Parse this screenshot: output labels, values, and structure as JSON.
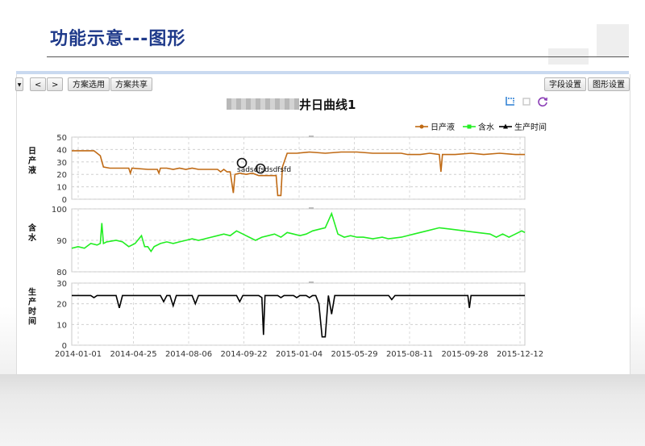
{
  "slide": {
    "title": "功能示意---图形"
  },
  "toolbar": {
    "prev_label": "<",
    "next_label": ">",
    "scheme_select_label": "方案选用",
    "scheme_share_label": "方案共享",
    "field_settings_label": "字段设置",
    "chart_settings_label": "图形设置"
  },
  "chart_title": {
    "suffix": "井日曲线1"
  },
  "icons": {
    "select": "select-icon",
    "crop": "crop-icon",
    "refresh": "refresh-icon"
  },
  "chart_data": {
    "type": "line",
    "title": "井日曲线1",
    "legend": {
      "position": "top-right",
      "entries": [
        "日产液",
        "含水",
        "生产时间"
      ]
    },
    "x_ticks": [
      "2014-01-01",
      "2014-04-25",
      "2014-08-06",
      "2014-09-22",
      "2015-01-04",
      "2015-05-29",
      "2015-08-11",
      "2015-09-28",
      "2015-12-12"
    ],
    "x_index_range": [
      0,
      100
    ],
    "annotation": "sadsdfsdsdfsfd",
    "panels": [
      {
        "ylabel": "日产液",
        "ylim": [
          0,
          50
        ],
        "yticks": [
          0,
          10,
          20,
          30,
          40,
          50
        ],
        "color": "#c06a14",
        "series": [
          {
            "name": "日产液",
            "points": [
              [
                0,
                39
              ],
              [
                3,
                39
              ],
              [
                5,
                39
              ],
              [
                7,
                39
              ],
              [
                9,
                35
              ],
              [
                10,
                26
              ],
              [
                12,
                25
              ],
              [
                16,
                25
              ],
              [
                18,
                25
              ],
              [
                18.5,
                21
              ],
              [
                19,
                25
              ],
              [
                24,
                24
              ],
              [
                26,
                24
              ],
              [
                27,
                24
              ],
              [
                27.5,
                21
              ],
              [
                28,
                25
              ],
              [
                30,
                25
              ],
              [
                32,
                24
              ],
              [
                34,
                25
              ],
              [
                36,
                24
              ],
              [
                38,
                25
              ],
              [
                40,
                24
              ],
              [
                42,
                24
              ],
              [
                44,
                24
              ],
              [
                46,
                24
              ],
              [
                47,
                22
              ],
              [
                48,
                24
              ],
              [
                49,
                22
              ],
              [
                50,
                22
              ],
              [
                51,
                5
              ],
              [
                51.5,
                20
              ],
              [
                53,
                21
              ],
              [
                55,
                20
              ],
              [
                57,
                21
              ],
              [
                59,
                19
              ],
              [
                61,
                19
              ],
              [
                63,
                19
              ],
              [
                64.5,
                19
              ],
              [
                65,
                3
              ],
              [
                66,
                3
              ],
              [
                66.5,
                26
              ],
              [
                68,
                37
              ],
              [
                71,
                37
              ],
              [
                75,
                38
              ],
              [
                80,
                37
              ],
              [
                85,
                38
              ],
              [
                90,
                38
              ],
              [
                95,
                37
              ],
              [
                100,
                37
              ],
              [
                104,
                37
              ],
              [
                106,
                36
              ],
              [
                110,
                36
              ],
              [
                113,
                37
              ],
              [
                116,
                36
              ],
              [
                116.5,
                22
              ],
              [
                117,
                36
              ],
              [
                121,
                36
              ],
              [
                126,
                37
              ],
              [
                130,
                36
              ],
              [
                135,
                37
              ],
              [
                140,
                36
              ],
              [
                143,
                36
              ]
            ]
          }
        ]
      },
      {
        "ylabel": "含水",
        "ylim": [
          80,
          100
        ],
        "yticks": [
          80,
          90,
          100
        ],
        "color": "#22ee22",
        "series": [
          {
            "name": "含水",
            "points": [
              [
                0,
                87.5
              ],
              [
                2,
                88
              ],
              [
                4,
                87.5
              ],
              [
                6,
                89
              ],
              [
                8,
                88.5
              ],
              [
                9,
                89
              ],
              [
                9.5,
                95.5
              ],
              [
                10,
                89
              ],
              [
                11,
                89.5
              ],
              [
                14,
                90
              ],
              [
                16,
                89.5
              ],
              [
                18,
                88
              ],
              [
                20,
                89
              ],
              [
                22,
                91.5
              ],
              [
                23,
                88
              ],
              [
                24,
                88
              ],
              [
                25,
                86.5
              ],
              [
                26,
                88
              ],
              [
                28,
                89
              ],
              [
                30,
                89.5
              ],
              [
                32,
                89
              ],
              [
                34,
                89.5
              ],
              [
                36,
                90
              ],
              [
                38,
                90.5
              ],
              [
                40,
                90
              ],
              [
                42,
                90.5
              ],
              [
                44,
                91
              ],
              [
                46,
                91.5
              ],
              [
                48,
                92
              ],
              [
                50,
                91.5
              ],
              [
                52,
                93
              ],
              [
                54,
                92
              ],
              [
                56,
                91
              ],
              [
                58,
                90
              ],
              [
                60,
                91
              ],
              [
                62,
                91.5
              ],
              [
                64,
                92
              ],
              [
                66,
                91
              ],
              [
                68,
                92.5
              ],
              [
                70,
                92
              ],
              [
                72,
                91.5
              ],
              [
                74,
                92
              ],
              [
                76,
                93
              ],
              [
                78,
                93.5
              ],
              [
                80,
                94
              ],
              [
                82,
                98.5
              ],
              [
                84,
                92
              ],
              [
                86,
                91
              ],
              [
                88,
                91.5
              ],
              [
                90,
                91
              ],
              [
                92,
                91
              ],
              [
                95,
                90.5
              ],
              [
                98,
                91
              ],
              [
                100,
                90.5
              ],
              [
                104,
                91
              ],
              [
                108,
                92
              ],
              [
                112,
                93
              ],
              [
                116,
                94
              ],
              [
                120,
                93.5
              ],
              [
                124,
                93
              ],
              [
                128,
                92.5
              ],
              [
                132,
                92
              ],
              [
                134,
                91
              ],
              [
                136,
                92
              ],
              [
                138,
                91
              ],
              [
                140,
                92
              ],
              [
                142,
                93
              ],
              [
                143,
                92.5
              ]
            ]
          }
        ]
      },
      {
        "ylabel": "生产时间",
        "ylim": [
          0,
          30
        ],
        "yticks": [
          0,
          10,
          20,
          30
        ],
        "color": "#000000",
        "series": [
          {
            "name": "生产时间",
            "points": [
              [
                0,
                24
              ],
              [
                6,
                24
              ],
              [
                7,
                23
              ],
              [
                8,
                24
              ],
              [
                14,
                24
              ],
              [
                15,
                18
              ],
              [
                16,
                24
              ],
              [
                28,
                24
              ],
              [
                29,
                21
              ],
              [
                30,
                24
              ],
              [
                31,
                24
              ],
              [
                32,
                19
              ],
              [
                33,
                24
              ],
              [
                38,
                24
              ],
              [
                39,
                20
              ],
              [
                40,
                24
              ],
              [
                42,
                24
              ],
              [
                52,
                24
              ],
              [
                53,
                21
              ],
              [
                54,
                24
              ],
              [
                59,
                24
              ],
              [
                60,
                23
              ],
              [
                60.5,
                5
              ],
              [
                61,
                24
              ],
              [
                65,
                24
              ],
              [
                66,
                23
              ],
              [
                67,
                24
              ],
              [
                70,
                24
              ],
              [
                71,
                23
              ],
              [
                72,
                24
              ],
              [
                74,
                24
              ],
              [
                75,
                23
              ],
              [
                76,
                24
              ],
              [
                77,
                24
              ],
              [
                78,
                20
              ],
              [
                79,
                4
              ],
              [
                80,
                4
              ],
              [
                81,
                24
              ],
              [
                82,
                15
              ],
              [
                83,
                24
              ],
              [
                100,
                24
              ],
              [
                101,
                22
              ],
              [
                102,
                24
              ],
              [
                125,
                24
              ],
              [
                125.5,
                18
              ],
              [
                126,
                24
              ],
              [
                143,
                24
              ]
            ]
          }
        ]
      }
    ]
  }
}
